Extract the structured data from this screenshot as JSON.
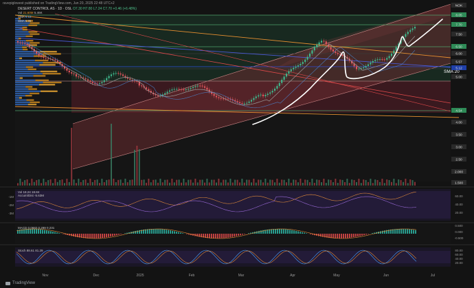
{
  "header": {
    "publisher": "ravepiglowest published on TradingView.com, Jun 20, 2025 22:48 UTC+2",
    "symbol_line": "DESERT CONTROL AS · 1D · OSL",
    "ohlc": "O7.30 H7.80 L7.24 C7.70 +0.46 (+6.48%)",
    "vol_label": "Vol",
    "vol_value": "21.60M",
    "vol_value2": "5.46K",
    "smas": [
      {
        "label": "SMA",
        "value": "6.12",
        "color": "#4aa3ff"
      },
      {
        "label": "SMA",
        "value": "6.05",
        "color": "#9a9a9a"
      }
    ]
  },
  "price_labels": [
    {
      "text": "NOK",
      "color": "#2a2a2a"
    },
    {
      "text": "8.05",
      "color": "#2e8b57"
    },
    {
      "text": "7.70",
      "color": "#2e8b57"
    },
    {
      "text": "7.50",
      "color": "#2a2a2a"
    },
    {
      "text": "6.50",
      "color": "#2e8b57"
    },
    {
      "text": "6.00",
      "color": "#2a2a2a"
    },
    {
      "text": "5.57",
      "color": "#2a2a2a"
    },
    {
      "text": "5.12",
      "color": "#1f3fa8"
    },
    {
      "text": "5.00",
      "color": "#2a2a2a"
    },
    {
      "text": "4.54",
      "color": "#2e8b57"
    },
    {
      "text": "4.00",
      "color": "#2a2a2a"
    },
    {
      "text": "3.50",
      "color": "#2a2a2a"
    },
    {
      "text": "3.00",
      "color": "#2a2a2a"
    },
    {
      "text": "2.50",
      "color": "#2a2a2a"
    },
    {
      "text": "2.000",
      "color": "#2a2a2a"
    },
    {
      "text": "1.500",
      "color": "#2a2a2a"
    }
  ],
  "sma_label": "SMA 20",
  "x_axis": [
    "Nov",
    "Dec",
    "2025",
    "Feb",
    "Mar",
    "Apr",
    "May",
    "Jun",
    "Jul"
  ],
  "panels": {
    "vol_label": "Vol 18.24 18.84",
    "accum": {
      "title": "Accum/Dist",
      "value": "-5.63M",
      "ticks": [
        "-1M",
        "-2M",
        "-3M"
      ],
      "ticks_right": [
        "60.00",
        "40.00",
        "20.00"
      ]
    },
    "macd": {
      "title": "MACD",
      "values": "0.0682 0.299 0.231",
      "ticks": [
        "0.500",
        "0.000",
        "-0.500"
      ]
    },
    "stoch": {
      "title": "Stoch",
      "values": "88.61 81.29",
      "ticks": [
        "80.00",
        "60.00",
        "40.00",
        "20.00"
      ]
    }
  },
  "footer": {
    "brand": "TradingView"
  }
}
